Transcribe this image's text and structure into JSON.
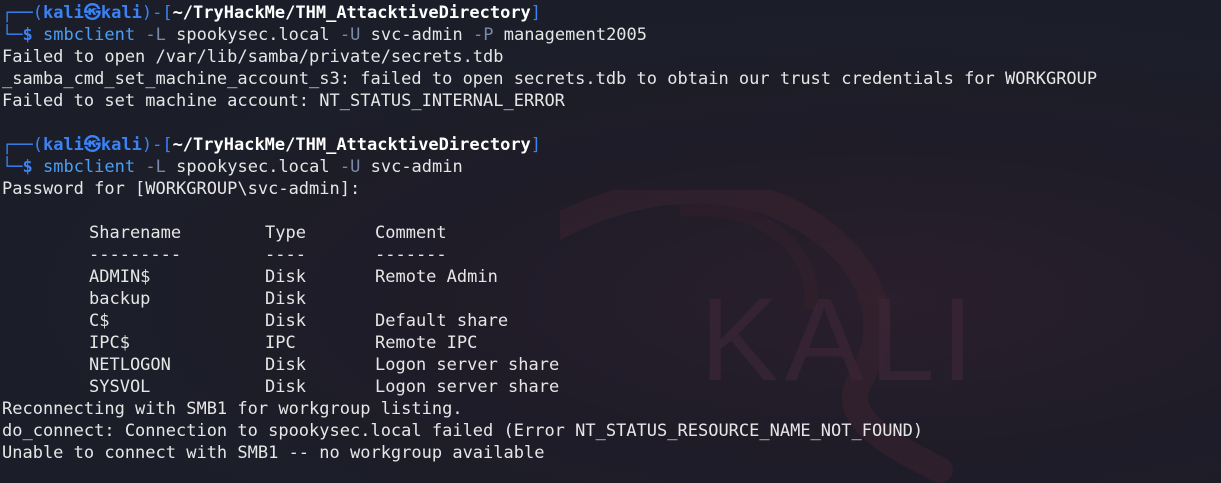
{
  "colors": {
    "background": "#1b1e29",
    "prompt_blue": "#3b83f5",
    "command": "#4a9ff5",
    "option": "#7a8aa8",
    "text": "#e6e6e6"
  },
  "watermark": {
    "text": "KALI"
  },
  "prompt1": {
    "top": "┌──(",
    "user": "kali㉿kali",
    "mid": ")-[",
    "path": "~/TryHackMe/THM_AttacktiveDirectory",
    "end": "]",
    "bottom": "└─",
    "dollar": "$",
    "cmd": "smbclient",
    "opt1": "-L",
    "arg1": "spookysec.local",
    "opt2": "-U",
    "arg2": "svc-admin",
    "opt3": "-P",
    "arg3": "management2005"
  },
  "output1": [
    "Failed to open /var/lib/samba/private/secrets.tdb",
    "_samba_cmd_set_machine_account_s3: failed to open secrets.tdb to obtain our trust credentials for WORKGROUP",
    "Failed to set machine account: NT_STATUS_INTERNAL_ERROR"
  ],
  "prompt2": {
    "top": "┌──(",
    "user": "kali㉿kali",
    "mid": ")-[",
    "path": "~/TryHackMe/THM_AttacktiveDirectory",
    "end": "]",
    "bottom": "└─",
    "dollar": "$",
    "cmd": "smbclient",
    "opt1": "-L",
    "arg1": "spookysec.local",
    "opt2": "-U",
    "arg2": "svc-admin"
  },
  "password_prompt": "Password for [WORKGROUP\\svc-admin]:",
  "shares": {
    "headers": [
      "Sharename",
      "Type",
      "Comment"
    ],
    "separators": [
      "---------",
      "----",
      "-------"
    ],
    "rows": [
      [
        "ADMIN$",
        "Disk",
        "Remote Admin"
      ],
      [
        "backup",
        "Disk",
        ""
      ],
      [
        "C$",
        "Disk",
        "Default share"
      ],
      [
        "IPC$",
        "IPC",
        "Remote IPC"
      ],
      [
        "NETLOGON",
        "Disk",
        "Logon server share"
      ],
      [
        "SYSVOL",
        "Disk",
        "Logon server share"
      ]
    ]
  },
  "output2": [
    "Reconnecting with SMB1 for workgroup listing.",
    "do_connect: Connection to spookysec.local failed (Error NT_STATUS_RESOURCE_NAME_NOT_FOUND)",
    "Unable to connect with SMB1 -- no workgroup available"
  ]
}
